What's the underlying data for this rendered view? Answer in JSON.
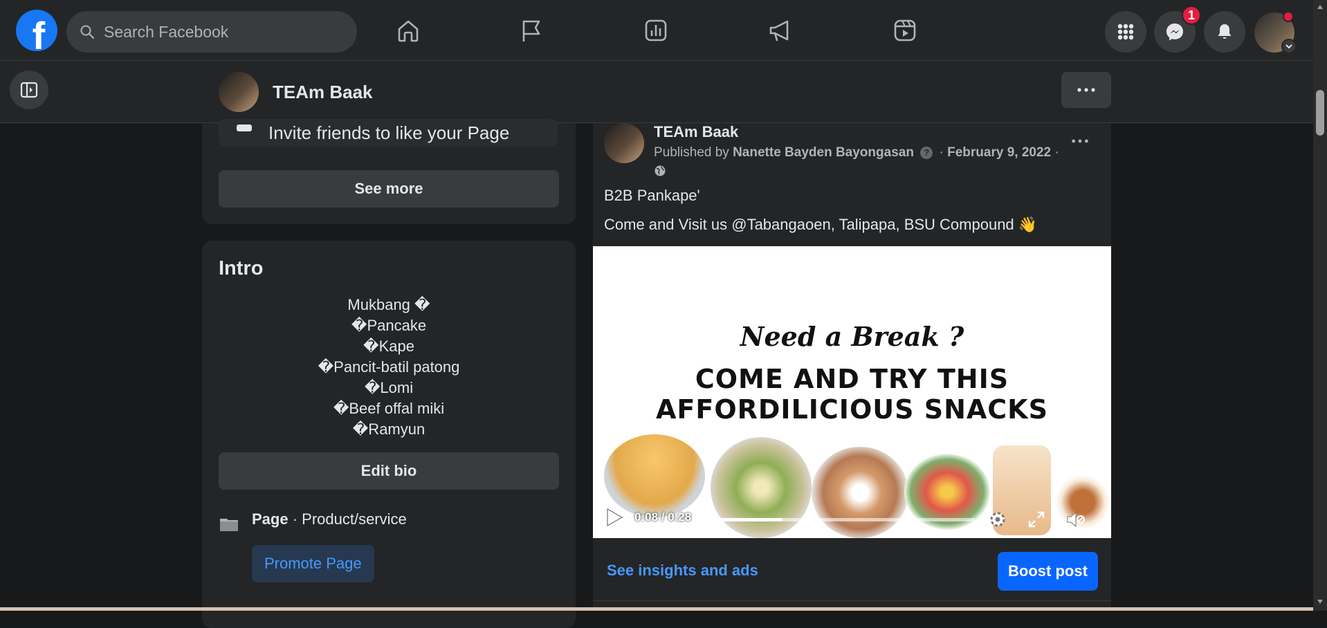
{
  "header": {
    "logo_letter": "f",
    "search_placeholder": "Search Facebook",
    "messenger_badge": "1",
    "nav_icons": [
      "home-icon",
      "flag-icon",
      "insights-icon",
      "megaphone-icon",
      "reels-icon"
    ],
    "right_icons": [
      "menu-grid-icon",
      "messenger-icon",
      "bell-icon"
    ]
  },
  "page_bar": {
    "page_name": "TEAm Baak",
    "more_label": "•••"
  },
  "left": {
    "invite_text": "Invite friends to like your Page",
    "see_more": "See more",
    "intro_title": "Intro",
    "bio_lines": [
      "Mukbang �",
      "�Pancake",
      "�Kape",
      "�Pancit-batil patong",
      "�Lomi",
      "�Beef offal miki",
      "�Ramyun"
    ],
    "edit_bio": "Edit bio",
    "page_label": "Page",
    "page_category": " · Product/service",
    "promote": "Promote Page"
  },
  "post": {
    "author": "TEAm Baak",
    "published_by_prefix": "Published by ",
    "publisher": "Nanette Bayden Bayongasan",
    "date": "February 9, 2022",
    "text1": "B2B Pankape'",
    "text2": "Come and Visit us @Tabangaoen, Talipapa, BSU Compound 👋",
    "media_line1": "Need a Break ?",
    "media_line2a": "COME AND TRY THIS",
    "media_line2b": "AFFORDILICIOUS SNACKS",
    "video_time": "0:08 / 0:28",
    "video_progress": 0.286,
    "insights": "See insights and ads",
    "boost": "Boost post"
  },
  "colors": {
    "accent": "#1877f2",
    "boost": "#0866ff",
    "link": "#4599ff",
    "background": "#18191a",
    "card": "#242526"
  }
}
